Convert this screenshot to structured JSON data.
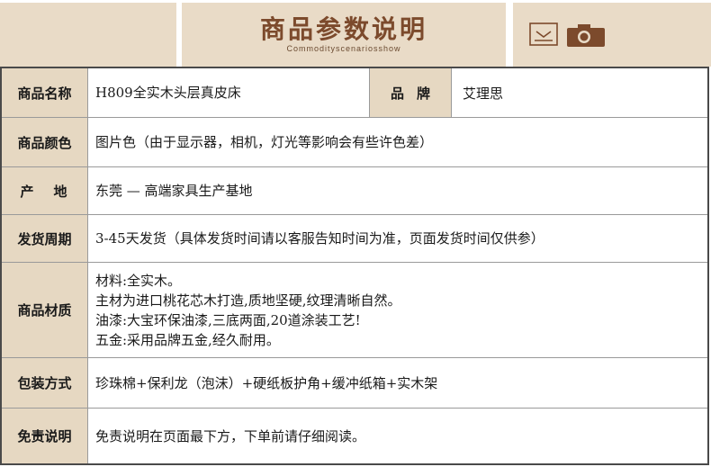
{
  "header": {
    "title": "商品参数说明",
    "subtitle": "Commodityscenariosshow",
    "left_color": "#e9dbc7",
    "accent_color": "#7c4a2c"
  },
  "icons": {
    "left": "inbox-icon",
    "right": "camera-icon"
  },
  "table": {
    "label_bg": "#e6d8c2",
    "rows": [
      {
        "label": "商品名称",
        "value": "H809全实木头层真皮床",
        "label2": "品牌",
        "value2": "艾理思"
      },
      {
        "label": "商品颜色",
        "value": "图片色（由于显示器，相机，灯光等影响会有些许色差）"
      },
      {
        "label": "产地",
        "value": "东莞 — 高端家具生产基地"
      },
      {
        "label": "发货周期",
        "value": "3-45天发货（具体发货时间请以客服告知时间为准，页面发货时间仅供参）"
      },
      {
        "label": "商品材质",
        "lines": [
          "材料:全实木。",
          "主材为进口桃花芯木打造,质地坚硬,纹理清晰自然。",
          "油漆:大宝环保油漆,三底两面,20道涂装工艺!",
          "五金:采用品牌五金,经久耐用。"
        ]
      },
      {
        "label": "包装方式",
        "value": "珍珠棉+保利龙（泡沫）+硬纸板护角+缓冲纸箱+实木架"
      },
      {
        "label": "免责说明",
        "value": "免责说明在页面最下方，下单前请仔细阅读。"
      }
    ]
  }
}
